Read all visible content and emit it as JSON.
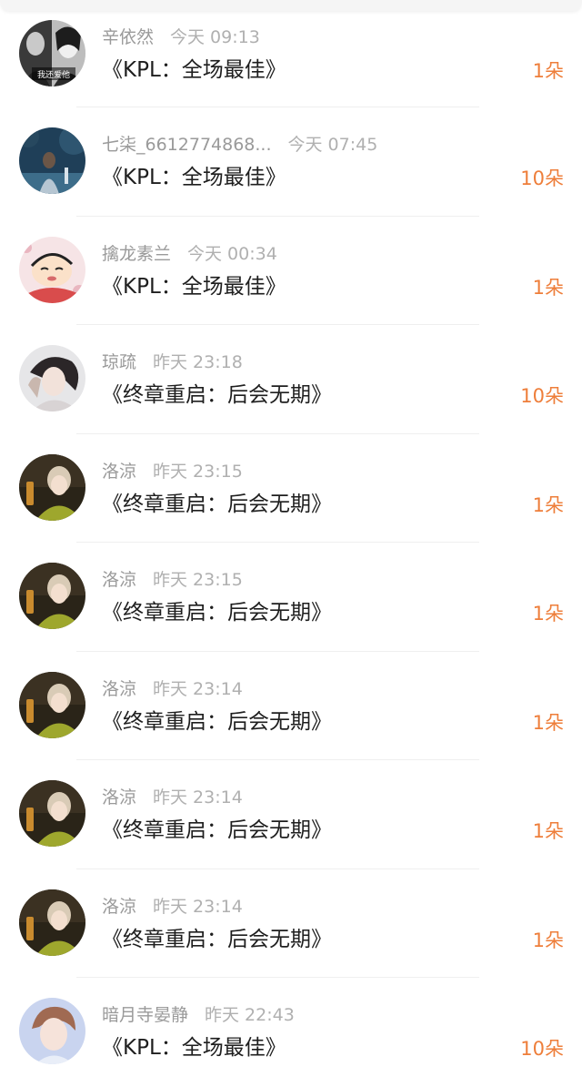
{
  "gift_list": {
    "items": [
      {
        "name": "辛依然",
        "time": "今天 09:13",
        "title": "《KPL：全场最佳》",
        "count": "1朵",
        "avatar_icon": "avatar-bw-photo-icon",
        "avatar_caption": "我还爱他"
      },
      {
        "name": "七柒_6612774868...",
        "time": "今天 07:45",
        "title": "《KPL：全场最佳》",
        "count": "10朵",
        "avatar_icon": "avatar-night-scene-icon"
      },
      {
        "name": "擒龙素兰",
        "time": "今天 00:34",
        "title": "《KPL：全场最佳》",
        "count": "1朵",
        "avatar_icon": "avatar-cartoon-icon"
      },
      {
        "name": "琼疏",
        "time": "昨天 23:18",
        "title": "《终章重启：后会无期》",
        "count": "10朵",
        "avatar_icon": "avatar-portrait-icon"
      },
      {
        "name": "洛涼",
        "time": "昨天 23:15",
        "title": "《终章重启：后会无期》",
        "count": "1朵",
        "avatar_icon": "avatar-girl-icon"
      },
      {
        "name": "洛涼",
        "time": "昨天 23:15",
        "title": "《终章重启：后会无期》",
        "count": "1朵",
        "avatar_icon": "avatar-girl-icon"
      },
      {
        "name": "洛涼",
        "time": "昨天 23:14",
        "title": "《终章重启：后会无期》",
        "count": "1朵",
        "avatar_icon": "avatar-girl-icon"
      },
      {
        "name": "洛涼",
        "time": "昨天 23:14",
        "title": "《终章重启：后会无期》",
        "count": "1朵",
        "avatar_icon": "avatar-girl-icon"
      },
      {
        "name": "洛涼",
        "time": "昨天 23:14",
        "title": "《终章重启：后会无期》",
        "count": "1朵",
        "avatar_icon": "avatar-girl-icon"
      },
      {
        "name": "暗月寺晏静",
        "time": "昨天 22:43",
        "title": "《KPL：全场最佳》",
        "count": "10朵",
        "avatar_icon": "avatar-boy-icon"
      }
    ]
  },
  "colors": {
    "count_accent": "#ee7e3a",
    "meta_gray": "#9c9c9c",
    "title_text": "#1e1e1e"
  }
}
